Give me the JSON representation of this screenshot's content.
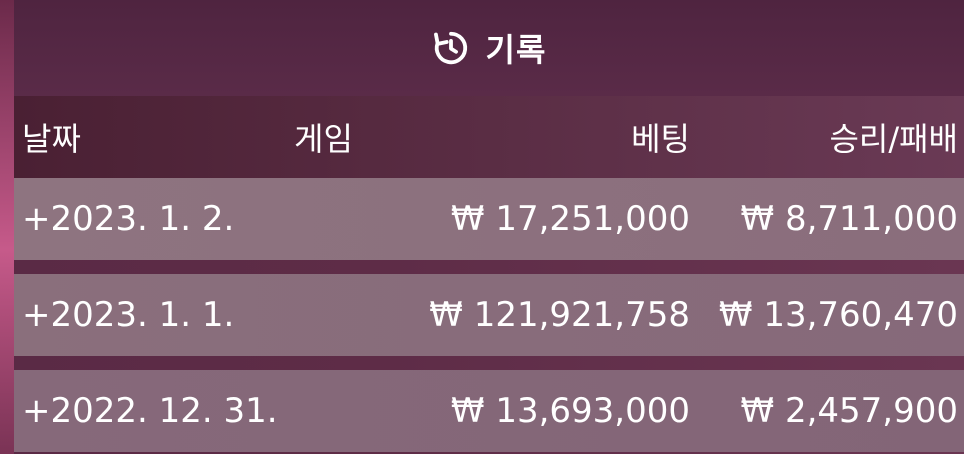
{
  "header": {
    "title": "기록",
    "icon": "history-icon"
  },
  "columns": {
    "date": "날짜",
    "game": "게임",
    "bet": "베팅",
    "win_loss": "승리/패배"
  },
  "rows": [
    {
      "date": "+2023. 1. 2.",
      "game": "",
      "bet": "₩ 17,251,000",
      "win_loss": "₩ 8,711,000"
    },
    {
      "date": "+2023. 1. 1.",
      "game": "",
      "bet": "₩ 121,921,758",
      "win_loss": "₩ 13,760,470"
    },
    {
      "date": "+2022. 12. 31.",
      "game": "",
      "bet": "₩ 13,693,000",
      "win_loss": "₩ 2,457,900"
    }
  ],
  "colors": {
    "background": "#5e2c47",
    "text": "#ffffff",
    "row": "#8a6d7c"
  }
}
